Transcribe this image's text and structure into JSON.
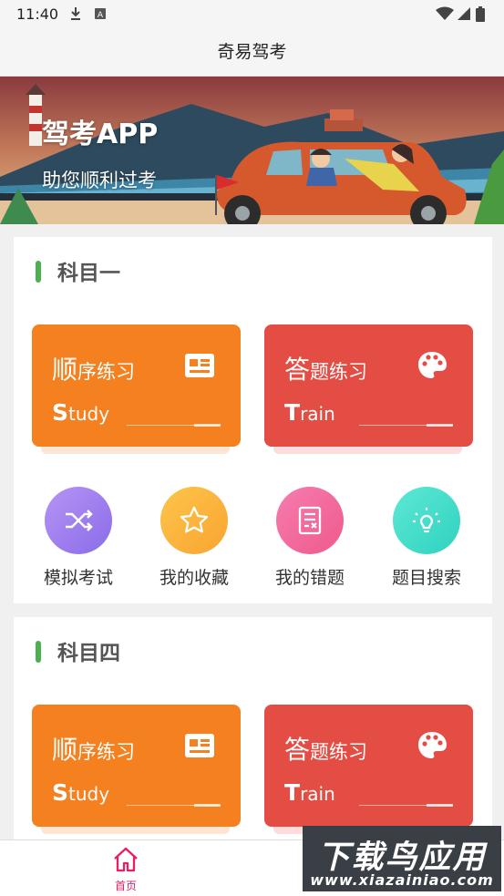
{
  "status_bar": {
    "time": "11:40"
  },
  "header": {
    "title": "奇易驾考"
  },
  "banner": {
    "title": "驾考APP",
    "subtitle": "助您顺利过考"
  },
  "sections": [
    {
      "title": "科目一",
      "cards": [
        {
          "label_first": "顺",
          "label_rest": "序练习",
          "sub_first": "S",
          "sub_rest": "tudy",
          "icon": "id-card-icon",
          "color": "#f5801f"
        },
        {
          "label_first": "答",
          "label_rest": "题练习",
          "sub_first": "T",
          "sub_rest": "rain",
          "icon": "palette-icon",
          "color": "#e44d44"
        }
      ],
      "quick_actions": [
        {
          "label": "模拟考试",
          "icon": "shuffle-icon",
          "color": "#a07df0"
        },
        {
          "label": "我的收藏",
          "icon": "star-icon",
          "color": "#fbb23b"
        },
        {
          "label": "我的错题",
          "icon": "wrong-list-icon",
          "color": "#f36aa0"
        },
        {
          "label": "题目搜索",
          "icon": "lightbulb-icon",
          "color": "#3fdcc8"
        }
      ]
    },
    {
      "title": "科目四",
      "cards": [
        {
          "label_first": "顺",
          "label_rest": "序练习",
          "sub_first": "S",
          "sub_rest": "tudy",
          "icon": "id-card-icon",
          "color": "#f5801f"
        },
        {
          "label_first": "答",
          "label_rest": "题练习",
          "sub_first": "T",
          "sub_rest": "rain",
          "icon": "palette-icon",
          "color": "#e44d44"
        }
      ]
    }
  ],
  "bottom_nav": {
    "home_label": "首页",
    "active_color": "#e91e63"
  },
  "watermark": {
    "main": "下载鸟应用",
    "url": "www.xiazainiao.com"
  }
}
